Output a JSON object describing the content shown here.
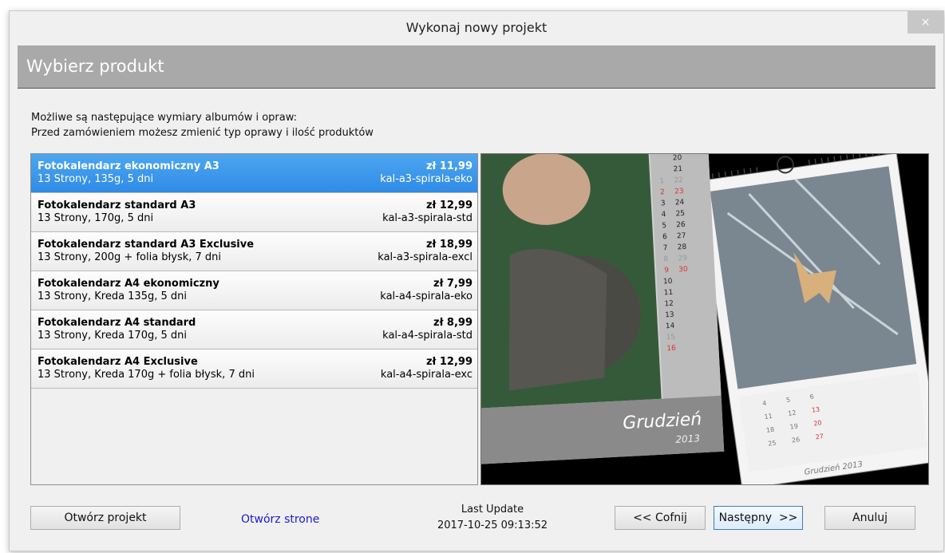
{
  "window": {
    "title": "Wykonaj nowy projekt",
    "close_label": "×"
  },
  "header": {
    "title": "Wybierz produkt"
  },
  "intro": {
    "line1": "Możliwe są następujące wymiary albumów i opraw:",
    "line2": "Przed zamówieniem możesz zmienić typ oprawy i ilość produktów"
  },
  "products": [
    {
      "name": "Fotokalendarz ekonomiczny A3",
      "desc": "13 Strony, 135g, 5 dni",
      "price": "zł 11,99",
      "code": "kal-a3-spirala-eko",
      "selected": true
    },
    {
      "name": "Fotokalendarz standard A3",
      "desc": "13 Strony, 170g, 5 dni",
      "price": "zł 12,99",
      "code": "kal-a3-spirala-std",
      "selected": false
    },
    {
      "name": "Fotokalendarz standard A3 Exclusive",
      "desc": "13 Strony, 200g + folia błysk, 7 dni",
      "price": "zł 18,99",
      "code": "kal-a3-spirala-excl",
      "selected": false
    },
    {
      "name": "Fotokalendarz A4 ekonomiczny",
      "desc": "13 Strony, Kreda 135g, 5 dni",
      "price": "zł 7,99",
      "code": "kal-a4-spirala-eko",
      "selected": false
    },
    {
      "name": "Fotokalendarz A4 standard",
      "desc": "13 Strony, Kreda 170g, 5 dni",
      "price": "zł 8,99",
      "code": "kal-a4-spirala-std",
      "selected": false
    },
    {
      "name": "Fotokalendarz A4 Exclusive",
      "desc": "13 Strony, Kreda 170g + folia błysk, 7 dni",
      "price": "zł 12,99",
      "code": "kal-a4-spirala-exc",
      "selected": false
    }
  ],
  "preview": {
    "month_label": "Grudzień",
    "year_label": "2013",
    "back_month_label": "Grudzień 2013",
    "day_numbers": [
      "20",
      "21",
      "22",
      "23",
      "24",
      "25",
      "26",
      "27",
      "28",
      "29",
      "30",
      "10",
      "11",
      "12",
      "13",
      "14",
      "15",
      "16"
    ],
    "left_col": [
      "1",
      "2",
      "3",
      "4",
      "5",
      "6",
      "7",
      "8",
      "9"
    ]
  },
  "footer": {
    "open_project": "Otwórz projekt",
    "open_page": "Otwórz strone",
    "last_update_label": "Last Update",
    "last_update_value": "2017-10-25 09:13:52",
    "back": "<< Cofnij",
    "next": "Następny  >>",
    "cancel": "Anuluj"
  },
  "colors": {
    "selection": "#3994ea",
    "link": "#1a1ad6",
    "header_band": "#a9a9a9"
  }
}
